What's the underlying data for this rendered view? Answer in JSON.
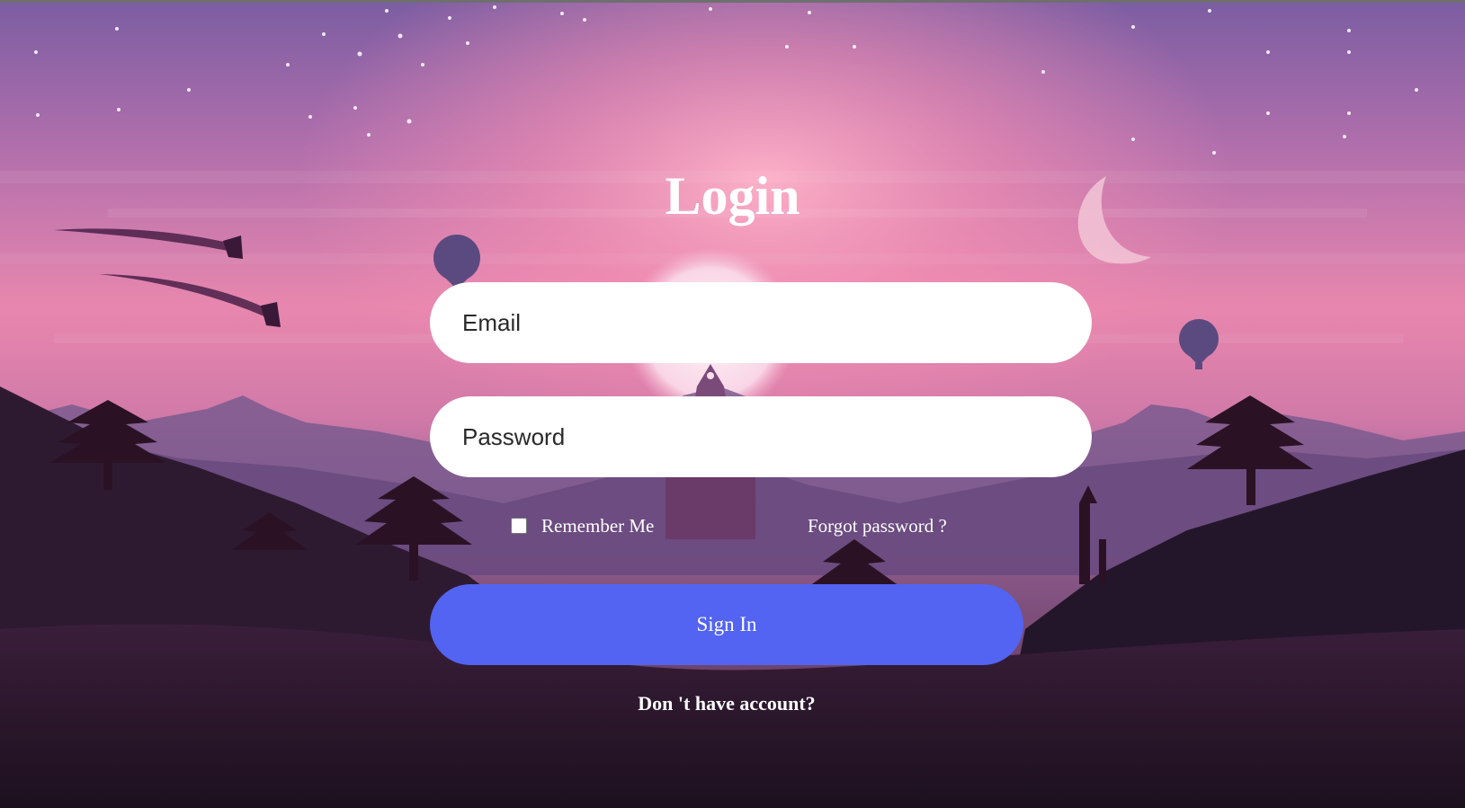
{
  "login": {
    "title": "Login",
    "email_placeholder": "Email",
    "password_placeholder": "Password",
    "remember_label": "Remember Me",
    "forgot_label": "Forgot password ?",
    "signin_label": "Sign In",
    "signup_prompt": "Don 't have account?"
  },
  "colors": {
    "button": "#5364f2",
    "sky_top": "#7a5aa0",
    "sky_glow": "#f48aae",
    "ground": "#241426"
  }
}
